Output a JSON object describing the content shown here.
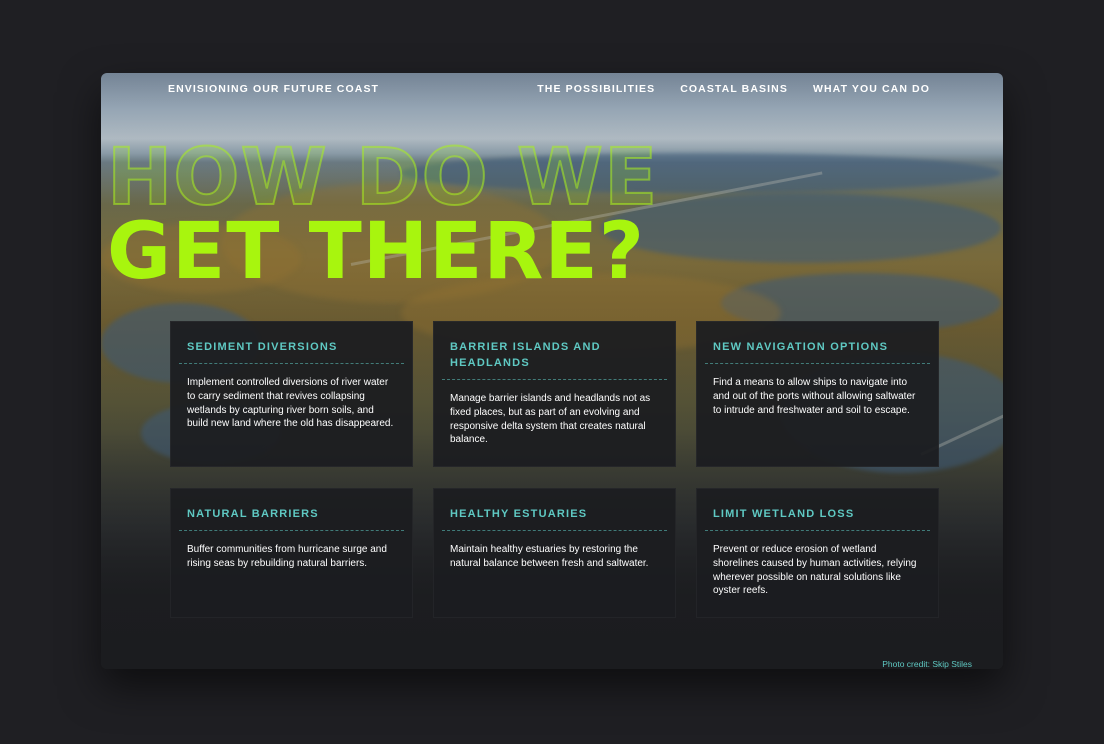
{
  "nav": {
    "brand": "ENVISIONING OUR FUTURE COAST",
    "links": [
      "THE POSSIBILITIES",
      "COASTAL BASINS",
      "WHAT YOU CAN DO"
    ]
  },
  "headline": {
    "line1": "HOW DO WE",
    "line2": "GET THERE?"
  },
  "cards": [
    {
      "title": "SEDIMENT DIVERSIONS",
      "body": "Implement controlled diversions of river water to carry sediment that revives collapsing wetlands by capturing river born soils, and build new land where the old has disappeared."
    },
    {
      "title": "BARRIER ISLANDS AND HEADLANDS",
      "body": "Manage barrier islands and headlands not as fixed places, but as part of an evolving and responsive delta system that creates natural balance."
    },
    {
      "title": "NEW NAVIGATION OPTIONS",
      "body": "Find a means to allow ships to navigate into and out of the ports without allowing saltwater to intrude and freshwater and soil to escape."
    },
    {
      "title": "NATURAL BARRIERS",
      "body": "Buffer communities from hurricane surge and rising seas by rebuilding natural barriers."
    },
    {
      "title": "HEALTHY ESTUARIES",
      "body": "Maintain healthy estuaries by restoring the natural balance between fresh and saltwater."
    },
    {
      "title": "LIMIT WETLAND LOSS",
      "body": "Prevent or reduce erosion of wetland shorelines caused by human activities, relying wherever possible on natural solutions like oyster reefs."
    }
  ],
  "credit": "Photo credit: Skip Stiles",
  "colors": {
    "accent_lime": "#a8f50e",
    "accent_teal": "#5fc9c3",
    "page_bg": "#1f1f23",
    "card_bg": "#1c1d20"
  }
}
